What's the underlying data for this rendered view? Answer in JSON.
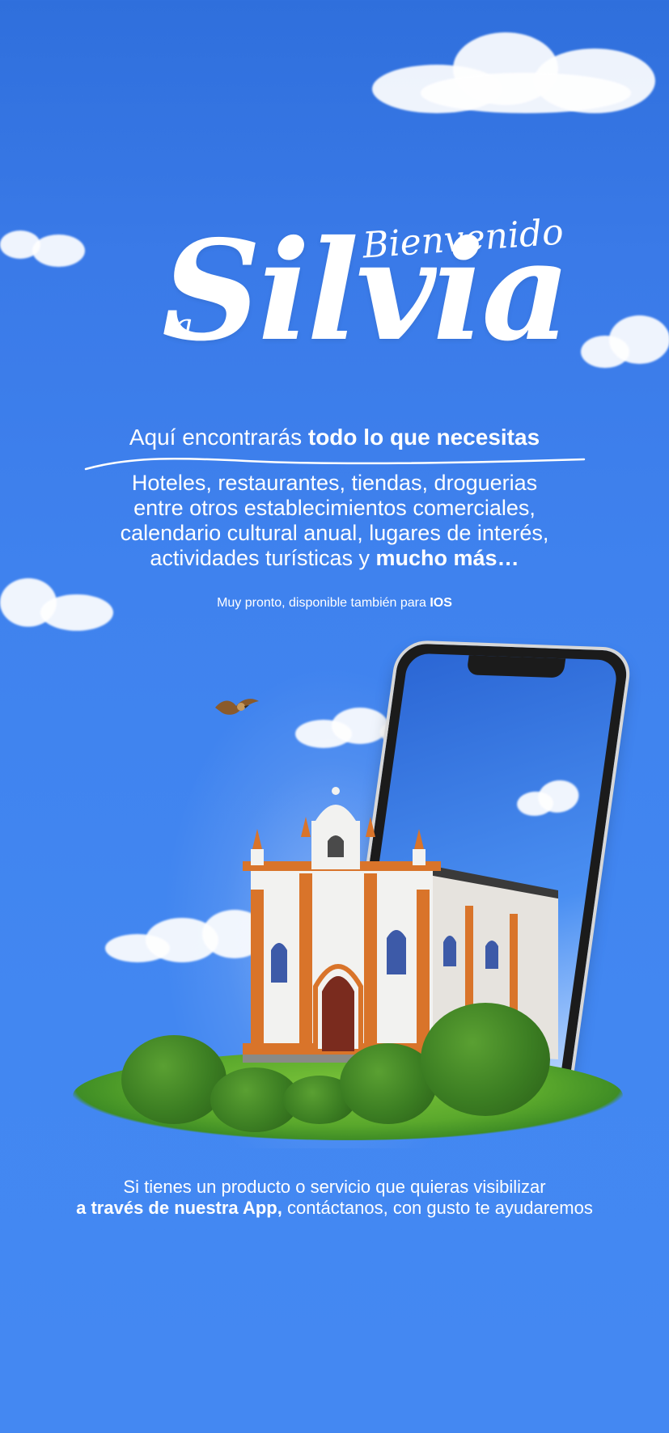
{
  "hero": {
    "title_small_top": "Bienvenido",
    "title_small_left": "a",
    "title_main": "Silvia"
  },
  "intro": {
    "text_regular": "Aquí encontrarás ",
    "text_bold": "todo lo que necesitas"
  },
  "description": {
    "line1": "Hoteles, restaurantes, tiendas, droguerias",
    "line2": "entre otros establecimientos comerciales,",
    "line3": "calendario cultural anual, lugares de interés,",
    "line4_regular": "actividades turísticas y ",
    "line4_bold": "mucho más…"
  },
  "availability": {
    "text_regular": "Muy pronto, disponible también para ",
    "text_bold": "IOS"
  },
  "footer": {
    "line1": "Si tienes un producto o servicio que quieras visibilizar",
    "line2_bold": "a través de nuestra App,",
    "line2_regular": " contáctanos, con gusto te ayudaremos"
  },
  "colors": {
    "sky": "#3f82ee",
    "church_wall": "#f2f2f0",
    "church_trim": "#d9742a",
    "door": "#7a2b1e",
    "grass": "#6cb834"
  },
  "icons": {
    "bird": "bird-illustration",
    "phone": "smartphone-illustration",
    "church": "church-illustration"
  }
}
